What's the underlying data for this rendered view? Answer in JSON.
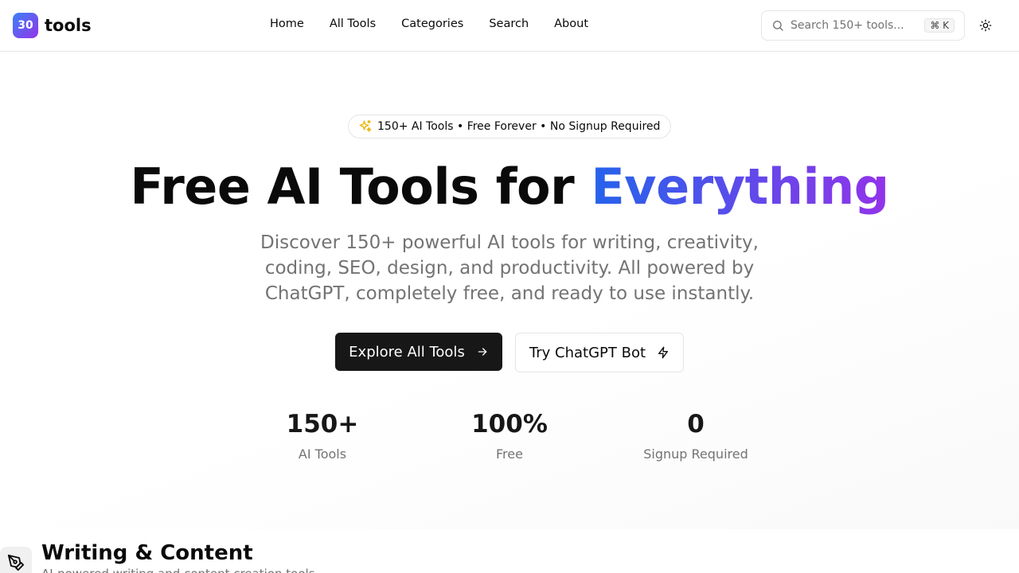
{
  "header": {
    "logo_badge": "30",
    "logo_text": "tools",
    "nav": [
      "Home",
      "All Tools",
      "Categories",
      "Search",
      "About"
    ],
    "search_placeholder": "Search 150+ tools...",
    "search_shortcut": "⌘ K",
    "theme_icon": "sun-icon"
  },
  "hero": {
    "pill_icon": "sparkles-icon",
    "pill_text": "150+ AI Tools • Free Forever • No Signup Required",
    "title_main": "Free AI Tools for ",
    "title_highlight": "Everything",
    "subtitle": "Discover 150+ powerful AI tools for writing, creativity, coding, SEO, design, and productivity. All powered by ChatGPT, completely free, and ready to use instantly.",
    "primary_button": "Explore All Tools",
    "secondary_button": "Try ChatGPT Bot",
    "stats": [
      {
        "value": "150+",
        "label": "AI Tools"
      },
      {
        "value": "100%",
        "label": "Free"
      },
      {
        "value": "0",
        "label": "Signup Required"
      }
    ]
  },
  "section": {
    "icon": "pen-tool-icon",
    "title": "Writing & Content",
    "subtitle": "AI-powered writing and content creation tools"
  },
  "colors": {
    "accent_start": "#2563eb",
    "accent_end": "#9333ea",
    "primary_button": "#171717",
    "pill_icon": "#eab308"
  }
}
